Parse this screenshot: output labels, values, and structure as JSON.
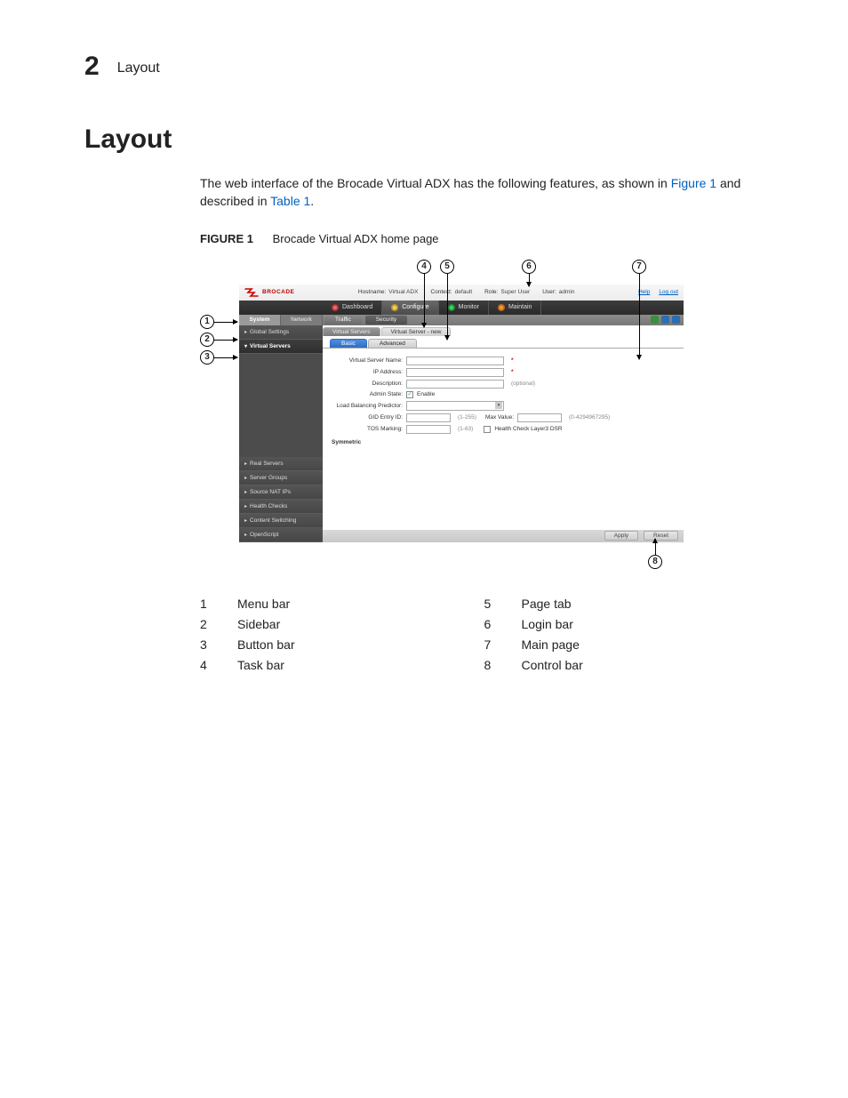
{
  "header": {
    "chapter_num": "2",
    "chapter_title": "Layout"
  },
  "title": "Layout",
  "intro": {
    "before_link1": "The web interface of the Brocade Virtual ADX has the following features, as shown in ",
    "link1": "Figure 1",
    "between": " and described in ",
    "link2": "Table 1",
    "after": "."
  },
  "figure_caption": {
    "label": "FIGURE 1",
    "text": "Brocade Virtual ADX home page"
  },
  "callouts": {
    "c1": "1",
    "c2": "2",
    "c3": "3",
    "c4": "4",
    "c5": "5",
    "c6": "6",
    "c7": "7",
    "c8": "8"
  },
  "topbar": {
    "logo_text": "BROCADE",
    "hostname_label": "Hostname:",
    "hostname_value": "Virtual ADX",
    "context_label": "Context:",
    "context_value": "default",
    "role_label": "Role:",
    "role_value": "Super User",
    "user_label": "User:",
    "user_value": "admin",
    "help": "Help",
    "logout": "Log out"
  },
  "nav": {
    "dashboard": "Dashboard",
    "configure": "Configure",
    "monitor": "Monitor",
    "maintain": "Maintain"
  },
  "submenu": {
    "system": "System",
    "network": "Network",
    "traffic": "Traffic",
    "security": "Security"
  },
  "sidebar": {
    "global_settings": "Global Settings",
    "virtual_servers": "Virtual Servers",
    "real_servers": "Real Servers",
    "server_groups": "Server Groups",
    "source_nat": "Source NAT IPs",
    "health_checks": "Health Checks",
    "content_switching": "Content Switching",
    "openscript": "OpenScript"
  },
  "crumbs": {
    "tab1": "Virtual Servers",
    "tab2": "Virtual Server - new"
  },
  "formtabs": {
    "basic": "Basic",
    "advanced": "Advanced"
  },
  "form": {
    "vsn_label": "Virtual Server Name:",
    "ip_label": "IP Address:",
    "desc_label": "Description:",
    "desc_hint": "(optional)",
    "admin_label": "Admin State:",
    "admin_value": "Enable",
    "lbp_label": "Load Balancing Predictor:",
    "gid_label": "GID Entry ID:",
    "gid_hint": "(1-255)",
    "max_label": "Max Value:",
    "max_hint": "(0-4294967295)",
    "tos_label": "TOS Marking:",
    "tos_hint": "(1-63)",
    "hc_label": "Health Check Layer3 DSR",
    "symmetric": "Symmetric",
    "required": "*"
  },
  "controls": {
    "apply": "Apply",
    "reset": "Reset"
  },
  "legend": {
    "left": [
      {
        "n": "1",
        "t": "Menu bar"
      },
      {
        "n": "2",
        "t": "Sidebar"
      },
      {
        "n": "3",
        "t": "Button bar"
      },
      {
        "n": "4",
        "t": "Task bar"
      }
    ],
    "right": [
      {
        "n": "5",
        "t": "Page tab"
      },
      {
        "n": "6",
        "t": "Login bar"
      },
      {
        "n": "7",
        "t": "Main page"
      },
      {
        "n": "8",
        "t": "Control bar"
      }
    ]
  }
}
